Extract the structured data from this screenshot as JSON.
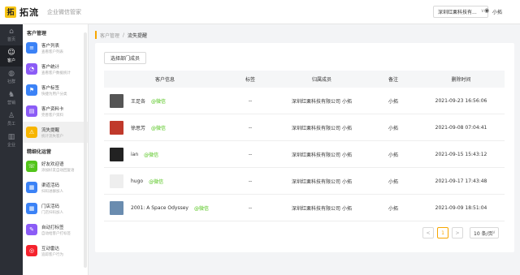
{
  "app": {
    "logo_glyph": "拓",
    "name": "拓流",
    "subtitle": "企业微信管家",
    "company": "深圳红栗科技有...",
    "user": "小拓"
  },
  "rail": [
    {
      "icon": "home-icon",
      "glyph": "⌂",
      "label": "首页",
      "active": false
    },
    {
      "icon": "customer-icon",
      "glyph": "☺",
      "label": "客户",
      "active": true
    },
    {
      "icon": "community-icon",
      "glyph": "◍",
      "label": "社群",
      "active": false
    },
    {
      "icon": "marketing-icon",
      "glyph": "♞",
      "label": "营销",
      "active": false
    },
    {
      "icon": "employee-icon",
      "glyph": "♙",
      "label": "员工",
      "active": false
    },
    {
      "icon": "enterprise-icon",
      "glyph": "▥",
      "label": "企业",
      "active": false
    }
  ],
  "submenu": {
    "section1": "客户管理",
    "items1": [
      {
        "title": "客户列表",
        "sub": "查看客户列表",
        "color": "#3b82f6",
        "glyph": "≡",
        "icon": "list-icon",
        "active": false
      },
      {
        "title": "客户统计",
        "sub": "查看客户数据统计",
        "color": "#8b5cf6",
        "glyph": "◔",
        "icon": "chart-icon",
        "active": false
      },
      {
        "title": "客户标签",
        "sub": "快捷为用户分类",
        "color": "#3b82f6",
        "glyph": "⚑",
        "icon": "tag-icon",
        "active": false
      },
      {
        "title": "客户资料卡",
        "sub": "完善客户资料",
        "color": "#8b5cf6",
        "glyph": "▤",
        "icon": "card-icon",
        "active": false
      },
      {
        "title": "流失提醒",
        "sub": "统计流失客户",
        "color": "#f7b500",
        "glyph": "⚠",
        "icon": "warning-icon",
        "active": true
      }
    ],
    "section2": "精细化运营",
    "items2": [
      {
        "title": "好友欢迎语",
        "sub": "添加好友自动回复语",
        "color": "#52c41a",
        "glyph": "☏",
        "icon": "chat-icon",
        "active": false
      },
      {
        "title": "渠道活码",
        "sub": "扫码进群加人",
        "color": "#3b82f6",
        "glyph": "▦",
        "icon": "qrcode-icon",
        "active": false
      },
      {
        "title": "门店活码",
        "sub": "门店扫码加人",
        "color": "#3b82f6",
        "glyph": "▦",
        "icon": "store-qrcode-icon",
        "active": false
      },
      {
        "title": "自动打标签",
        "sub": "自动给客户打标签",
        "color": "#8b5cf6",
        "glyph": "✎",
        "icon": "auto-tag-icon",
        "active": false
      },
      {
        "title": "互动雷达",
        "sub": "追踪客户行为",
        "color": "#f5222d",
        "glyph": "◎",
        "icon": "radar-icon",
        "active": false
      }
    ]
  },
  "breadcrumb": {
    "parent": "客户管理",
    "sep": "/",
    "current": "流失提醒"
  },
  "filter_button": "选择部门成员",
  "table": {
    "headers": [
      "客户信息",
      "标签",
      "归属成员",
      "备注",
      "删除时间"
    ],
    "rows": [
      {
        "name": "王足各",
        "wx": "@微信",
        "tag": "--",
        "owner": "深圳红栗科技有限公司 小拓",
        "note": "小拓",
        "time": "2021-09-23 16:56:06",
        "avatar_color": "#555555"
      },
      {
        "name": "徐思芳",
        "wx": "@微信",
        "tag": "--",
        "owner": "深圳红栗科技有限公司 小拓",
        "note": "小拓",
        "time": "2021-09-08 07:04:41",
        "avatar_color": "#c0392b"
      },
      {
        "name": "ian",
        "wx": "@微信",
        "tag": "--",
        "owner": "深圳红栗科技有限公司 小拓",
        "note": "小拓",
        "time": "2021-09-15 15:43:12",
        "avatar_color": "#222222"
      },
      {
        "name": "hugo",
        "wx": "@微信",
        "tag": "--",
        "owner": "深圳红栗科技有限公司 小拓",
        "note": "小拓",
        "time": "2021-09-17 17:43:48",
        "avatar_color": "#eeeeee"
      },
      {
        "name": "2001: A Space Odyssey",
        "wx": "@微信",
        "tag": "--",
        "owner": "深圳红栗科技有限公司 小拓",
        "note": "小拓",
        "time": "2021-09-09 18:51:04",
        "avatar_color": "#6a8caf"
      }
    ]
  },
  "pagination": {
    "prev": "<",
    "page": "1",
    "next": ">",
    "page_size": "10 条/页"
  },
  "colors": {
    "accent": "#f7a600",
    "wechat_green": "#52c41a",
    "rail_bg": "#2c2f36"
  }
}
